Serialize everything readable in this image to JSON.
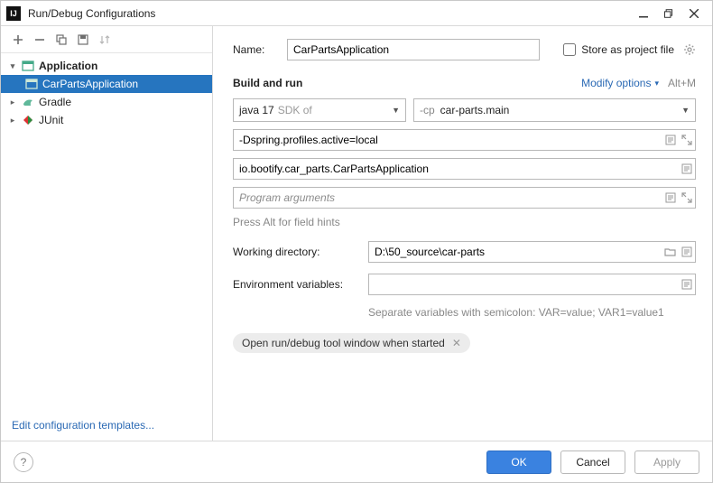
{
  "window": {
    "title": "Run/Debug Configurations"
  },
  "sidebar": {
    "items": [
      {
        "label": "Application",
        "expanded": true,
        "bold": true
      },
      {
        "label": "CarPartsApplication",
        "selected": true
      },
      {
        "label": "Gradle",
        "expanded": false
      },
      {
        "label": "JUnit",
        "expanded": false
      }
    ],
    "edit_templates": "Edit configuration templates..."
  },
  "form": {
    "name_label": "Name:",
    "name_value": "CarPartsApplication",
    "store_label": "Store as project file",
    "section": "Build and run",
    "modify": "Modify options",
    "modify_shortcut": "Alt+M",
    "sdk": {
      "value": "java 17",
      "suffix": "SDK of"
    },
    "cp": {
      "prefix": "-cp",
      "value": "car-parts.main"
    },
    "vm_options": "-Dspring.profiles.active=local",
    "main_class": "io.bootify.car_parts.CarPartsApplication",
    "program_args_placeholder": "Program arguments",
    "hint": "Press Alt for field hints",
    "workdir_label": "Working directory:",
    "workdir_value": "D:\\50_source\\car-parts",
    "env_label": "Environment variables:",
    "env_value": "",
    "env_hint": "Separate variables with semicolon: VAR=value; VAR1=value1",
    "chip": "Open run/debug tool window when started"
  },
  "buttons": {
    "ok": "OK",
    "cancel": "Cancel",
    "apply": "Apply"
  }
}
